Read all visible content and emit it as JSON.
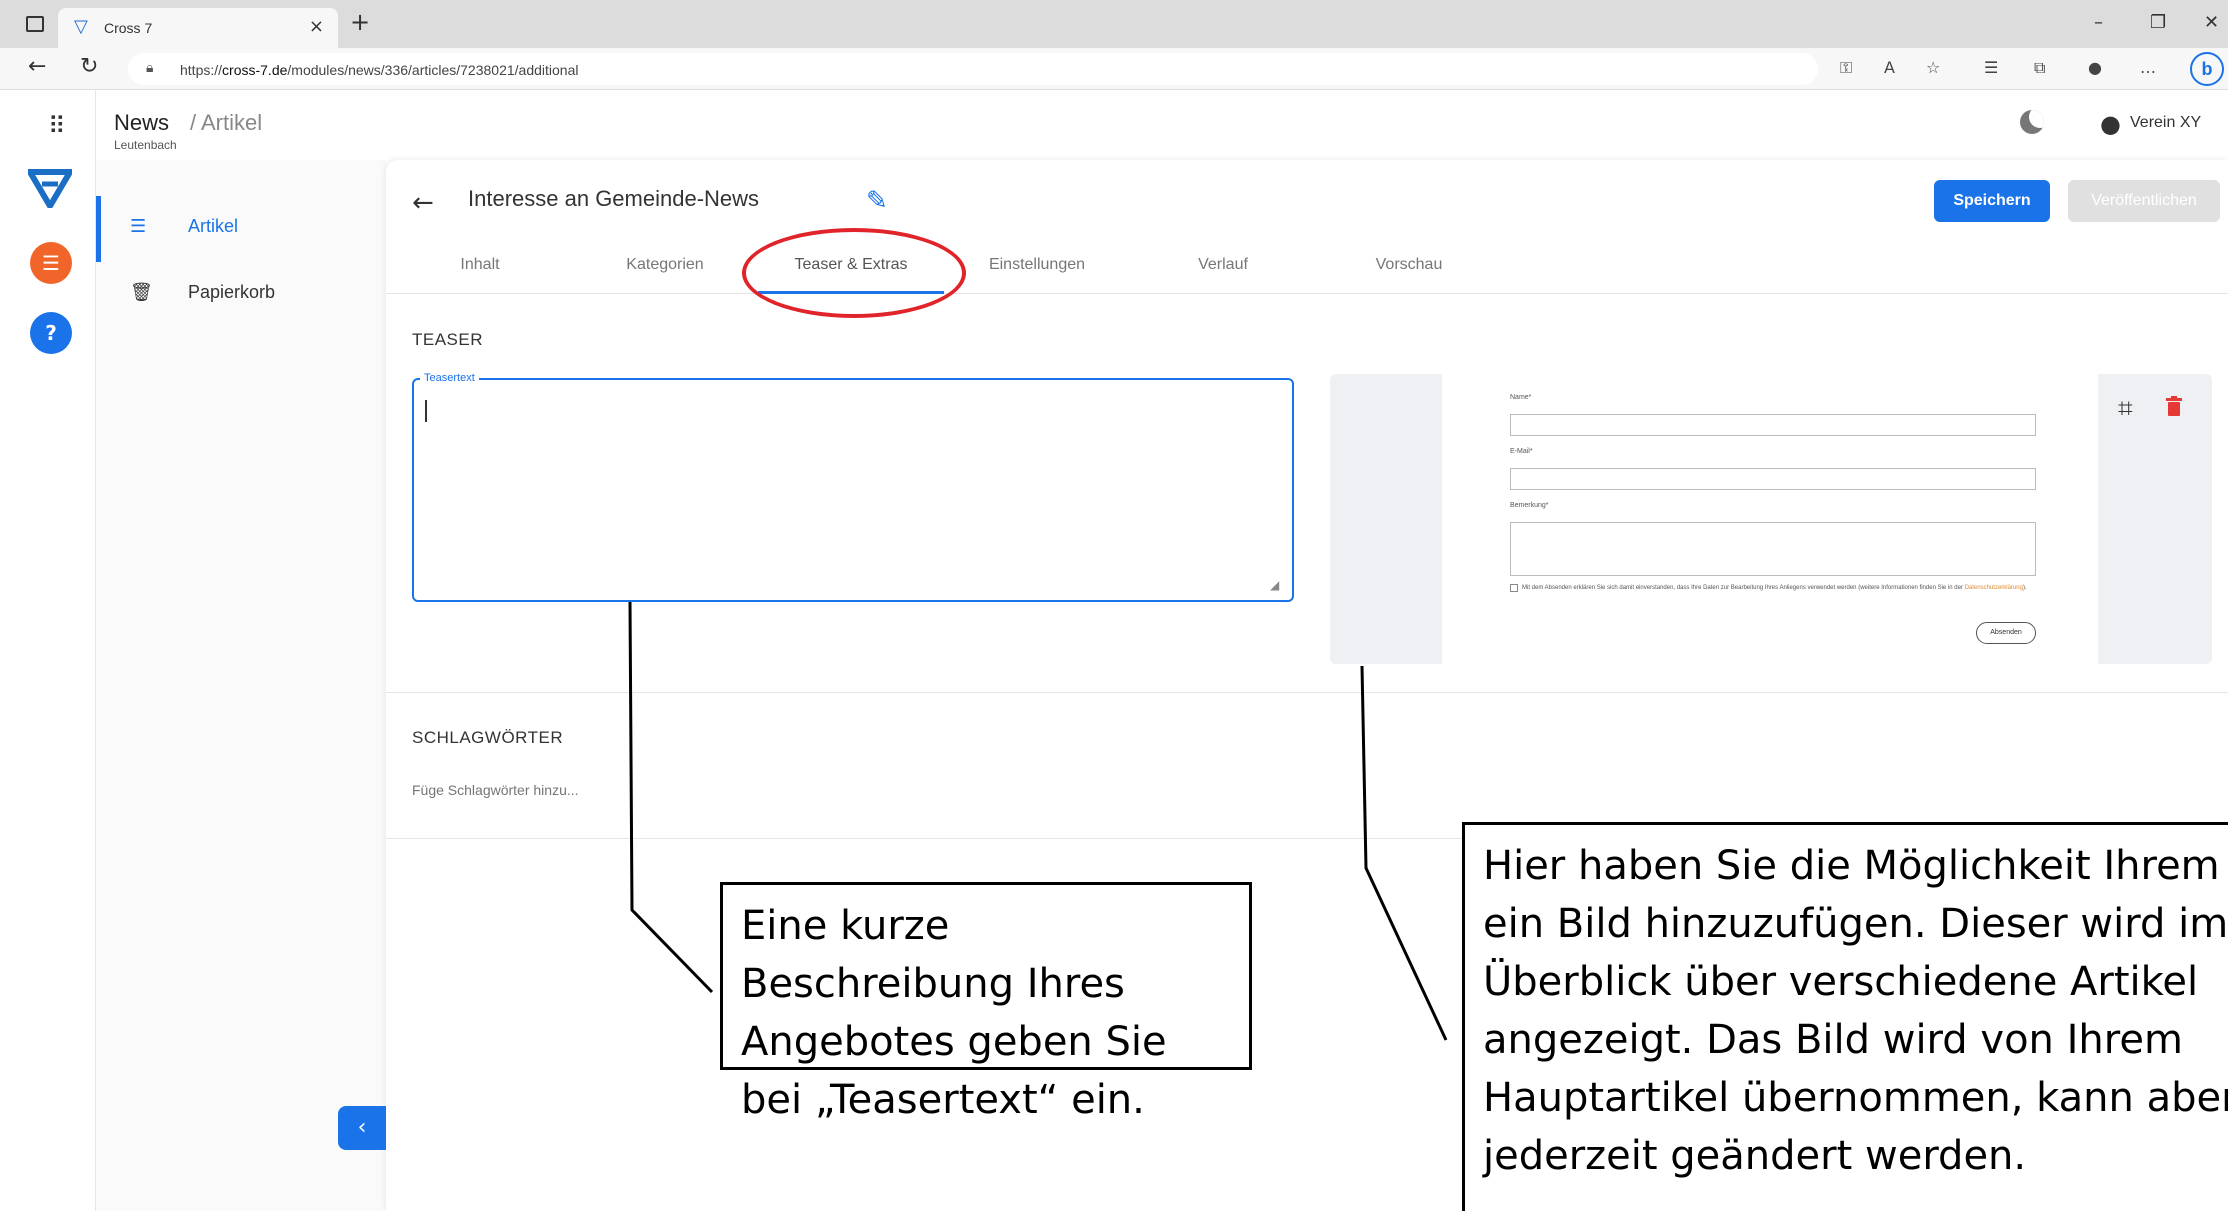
{
  "browser": {
    "tab_title": "Cross 7",
    "url_prefix": "https://",
    "url_domain": "cross-7.de",
    "url_path": "/modules/news/336/articles/7238021/additional"
  },
  "header": {
    "title": "News",
    "breadcrumb": "/ Artikel",
    "subtitle": "Leutenbach",
    "user_name": "Verein XY"
  },
  "subnav": {
    "items": [
      {
        "label": "Artikel",
        "icon": "list-icon",
        "active": true
      },
      {
        "label": "Papierkorb",
        "icon": "trash-icon",
        "active": false
      }
    ]
  },
  "article": {
    "title": "Interesse an Gemeinde-News",
    "save_label": "Speichern",
    "publish_label": "Veröffentlichen"
  },
  "tabs": [
    {
      "label": "Inhalt"
    },
    {
      "label": "Kategorien"
    },
    {
      "label": "Teaser & Extras",
      "active": true
    },
    {
      "label": "Einstellungen"
    },
    {
      "label": "Verlauf"
    },
    {
      "label": "Vorschau"
    }
  ],
  "teaser": {
    "section_label": "TEASER",
    "field_label": "Teasertext",
    "value": ""
  },
  "image_preview": {
    "name_label": "Name*",
    "email_label": "E-Mail*",
    "remark_label": "Bemerkung*",
    "consent_text": "Mit dem Absenden erklären Sie sich damit einverstanden, dass Ihre Daten zur Bearbeitung Ihres Anliegens verwendet werden (weitere Informationen finden Sie in der",
    "consent_link": "Datenschutzerklärung",
    "consent_end": ").",
    "submit_label": "Absenden"
  },
  "tags": {
    "section_label": "SCHLAGWÖRTER",
    "placeholder": "Füge Schlagwörter hinzu..."
  },
  "annotations": {
    "left_callout": "Eine kurze Beschreibung Ihres Angebotes geben Sie bei „Teasertext“ ein.",
    "right_callout_lines": [
      "Hier haben Sie die Möglichkeit Ihrem A",
      "ein Bild hinzuzufügen. Dieser wird im",
      "Überblick über verschiedene Artikel",
      "angezeigt. Das Bild wird von Ihrem",
      "Hauptartikel übernommen, kann aber",
      "jederzeit geändert werden."
    ],
    "highlight_color": "#e0242a"
  },
  "colors": {
    "accent": "#1a73e8",
    "orange_badge": "#f2652a",
    "blue_badge": "#1a73e8",
    "delete_red": "#e53935"
  }
}
